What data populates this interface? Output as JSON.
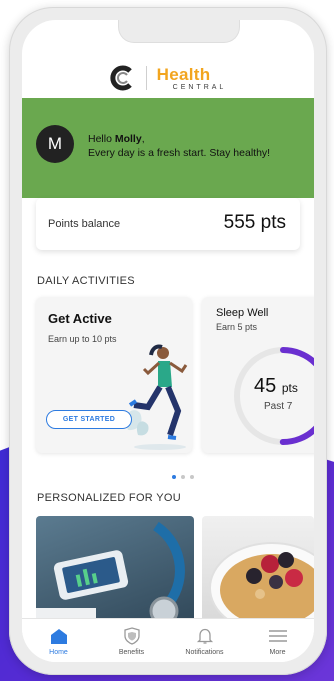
{
  "header": {
    "logo_health": "Health",
    "logo_central": "CENTRAL",
    "logo_mark": "C"
  },
  "greeting": {
    "avatar_initial": "M",
    "hello": "Hello",
    "name": "Molly",
    "message": "Every day is a fresh start. Stay healthy!"
  },
  "points": {
    "label": "Points balance",
    "value": "555 pts"
  },
  "daily": {
    "title": "DAILY ACTIVITIES",
    "active_card": {
      "title": "Get Active",
      "subtitle": "Earn up to 10 pts",
      "button": "GET STARTED"
    },
    "sleep_card": {
      "title": "Sleep Well",
      "subtitle": "Earn 5 pts",
      "value": "45",
      "unit": "pts",
      "caption": "Past 7",
      "progress": 0.5
    },
    "carousel_page": 1,
    "carousel_count": 3
  },
  "personalized": {
    "title": "PERSONALIZED FOR YOU"
  },
  "nav": {
    "items": [
      {
        "label": "Home",
        "icon": "home-icon",
        "active": true
      },
      {
        "label": "Benefits",
        "icon": "shield-icon",
        "active": false
      },
      {
        "label": "Notifications",
        "icon": "bell-icon",
        "active": false
      },
      {
        "label": "More",
        "icon": "menu-icon",
        "active": false
      }
    ]
  },
  "colors": {
    "accent": "#2d7be0",
    "greeting_bg": "#6aa84f",
    "ring": "#6a2fd0",
    "logo_orange": "#f2a51f"
  }
}
